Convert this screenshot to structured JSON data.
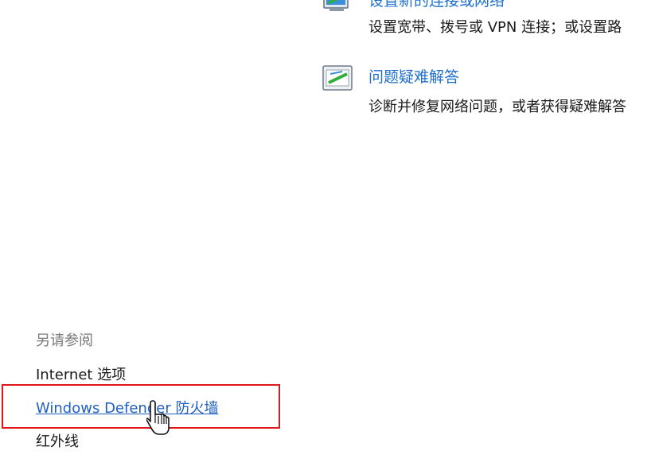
{
  "tasks": [
    {
      "icon": "network-setup-icon",
      "title": "设置新的连接或网络",
      "description": "设置宽带、拨号或 VPN 连接；或设置路"
    },
    {
      "icon": "troubleshoot-icon",
      "title": "问题疑难解答",
      "description": "诊断并修复网络问题，或者获得疑难解答"
    }
  ],
  "see_also": {
    "heading": "另请参阅",
    "links": [
      {
        "label": "Internet 选项"
      },
      {
        "label": "Windows Defender 防火墙",
        "state": "hover"
      },
      {
        "label": "红外线"
      }
    ]
  },
  "highlight_color": "#e0181c",
  "link_color": "#1f6fd0",
  "cursor_icon": "hand-pointer-icon"
}
